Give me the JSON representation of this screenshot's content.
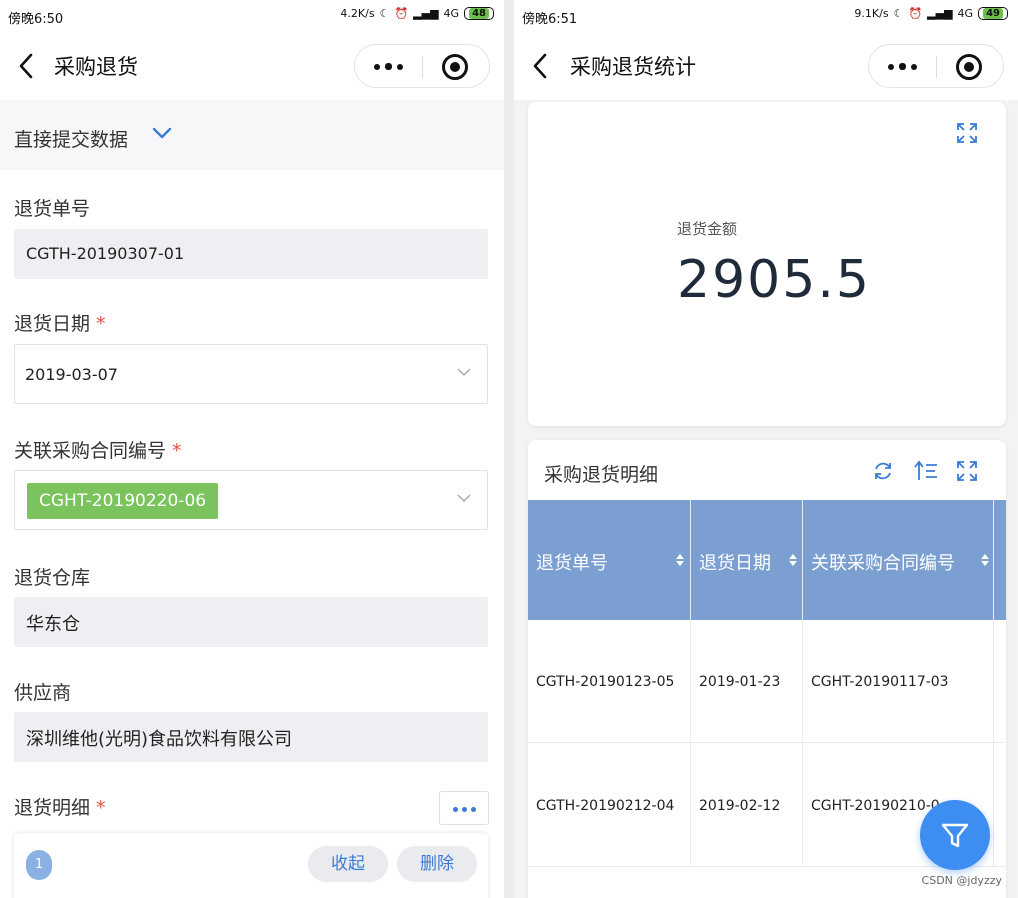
{
  "left": {
    "status": {
      "time": "傍晚6:50",
      "speed": "4.2K/s",
      "network": "4G",
      "battery": "48"
    },
    "nav": {
      "title": "采购退货"
    },
    "submit_mode": "直接提交数据",
    "fields": {
      "return_no": {
        "label": "退货单号",
        "value": "CGTH-20190307-01"
      },
      "return_date": {
        "label": "退货日期",
        "value": "2019-03-07"
      },
      "contract_no": {
        "label": "关联采购合同编号",
        "tag": "CGHT-20190220-06"
      },
      "warehouse": {
        "label": "退货仓库",
        "value": "华东仓"
      },
      "supplier": {
        "label": "供应商",
        "value": "深圳维他(光明)食品饮料有限公司"
      },
      "details": {
        "label": "退货明细"
      }
    },
    "required_mark": "*",
    "detail_card": {
      "index": "1",
      "collapse_label": "收起",
      "delete_label": "删除"
    }
  },
  "right": {
    "status": {
      "time": "傍晚6:51",
      "speed": "9.1K/s",
      "network": "4G",
      "battery": "49"
    },
    "nav": {
      "title": "采购退货统计"
    },
    "metric": {
      "label": "退货金额",
      "value": "2905.5"
    },
    "table": {
      "title": "采购退货明细",
      "columns": [
        "退货单号",
        "退货日期",
        "关联采购合同编号"
      ],
      "rows": [
        [
          "CGTH-20190123-05",
          "2019-01-23",
          "CGHT-20190117-03"
        ],
        [
          "CGTH-20190212-04",
          "2019-02-12",
          "CGHT-20190210-0"
        ]
      ]
    },
    "watermark": "CSDN @jdyzzy"
  },
  "colors": {
    "accent": "#3a7bd5",
    "tag": "#7ac35d",
    "header": "#7b9fd0",
    "fab": "#3d8ef0",
    "required": "#e2523e"
  }
}
